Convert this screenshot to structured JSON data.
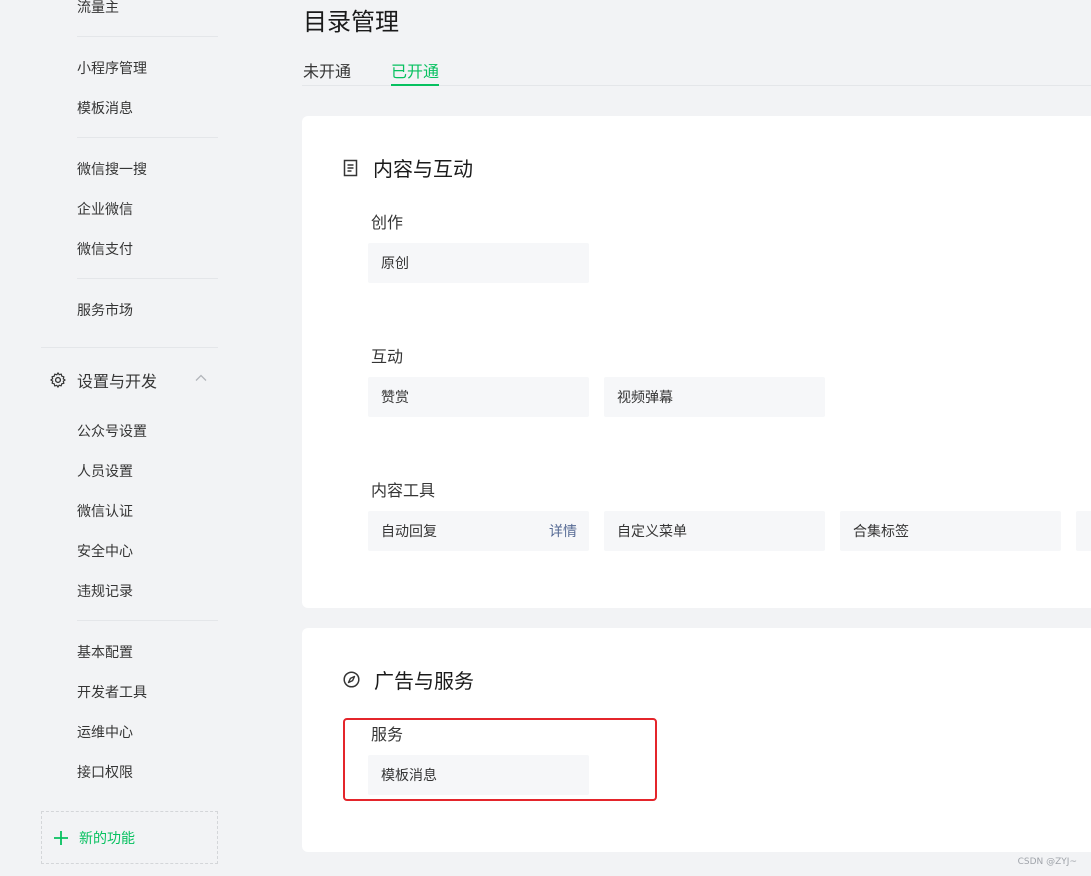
{
  "sidebar": {
    "top_item": "流量主",
    "group1": [
      "小程序管理",
      "模板消息"
    ],
    "group2": [
      "微信搜一搜",
      "企业微信",
      "微信支付"
    ],
    "group3": [
      "服务市场"
    ],
    "section": {
      "label": "设置与开发",
      "icon": "gear-icon",
      "items1": [
        "公众号设置",
        "人员设置",
        "微信认证",
        "安全中心",
        "违规记录"
      ],
      "items2": [
        "基本配置",
        "开发者工具",
        "运维中心",
        "接口权限"
      ]
    },
    "new_features": "新的功能"
  },
  "page": {
    "title": "目录管理",
    "tabs": [
      "未开通",
      "已开通"
    ],
    "active_tab": "已开通"
  },
  "cards": {
    "content": {
      "title": "内容与互动",
      "icon": "document-icon",
      "groups": {
        "creation": {
          "title": "创作",
          "items": [
            "原创"
          ]
        },
        "interaction": {
          "title": "互动",
          "items": [
            "赞赏",
            "视频弹幕"
          ]
        },
        "tools": {
          "title": "内容工具",
          "items": [
            "自动回复",
            "自定义菜单",
            "合集标签"
          ],
          "detail": "详情"
        }
      }
    },
    "ads": {
      "title": "广告与服务",
      "icon": "compass-icon",
      "groups": {
        "service": {
          "title": "服务",
          "items": [
            "模板消息"
          ]
        }
      }
    }
  },
  "watermark": "CSDN @ZYJ~",
  "colors": {
    "accent": "#07c160",
    "link": "#576b95",
    "highlight": "#e4252b",
    "background": "#f2f3f5"
  }
}
